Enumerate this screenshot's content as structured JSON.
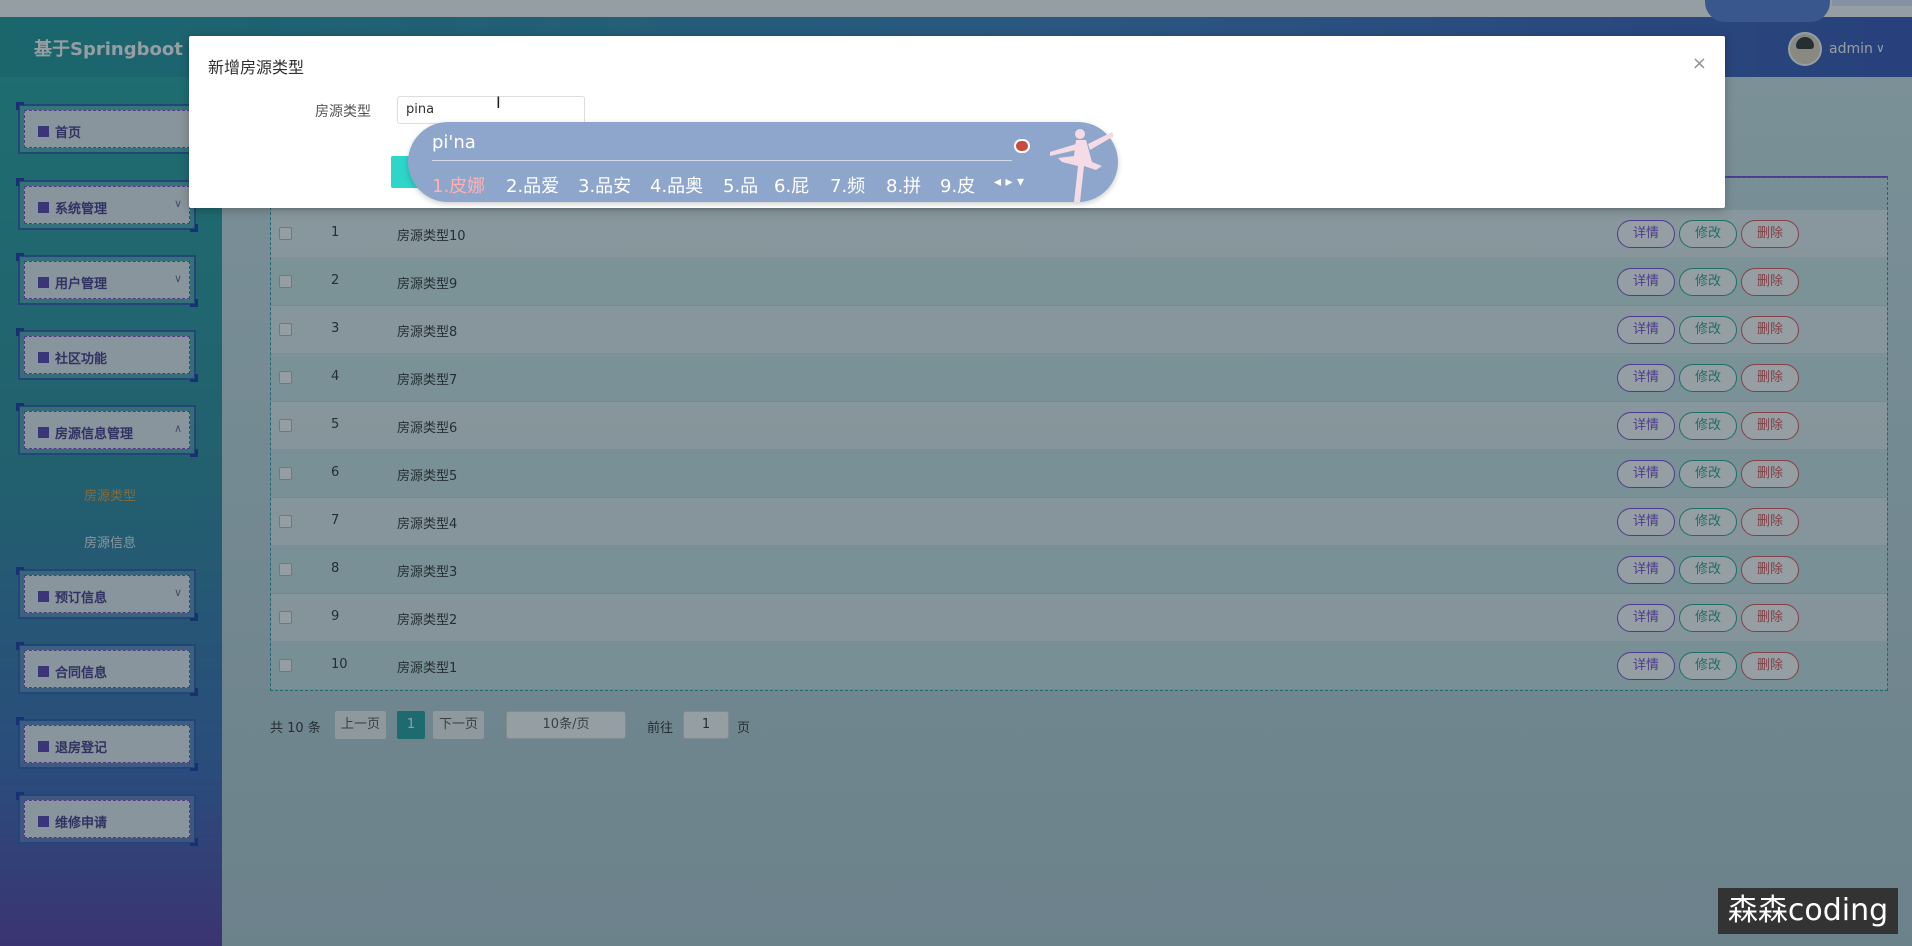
{
  "header": {
    "title": "基于Springboot",
    "username": "admin",
    "caret": "∨"
  },
  "sidebar": {
    "items": [
      {
        "label": "首页",
        "icon": "home-icon",
        "caret": ""
      },
      {
        "label": "系统管理",
        "icon": "grid-icon",
        "caret": "∨"
      },
      {
        "label": "用户管理",
        "icon": "folder-icon",
        "caret": "∨"
      },
      {
        "label": "社区功能",
        "icon": "grid-icon",
        "caret": ""
      },
      {
        "label": "房源信息管理",
        "icon": "doc-icon",
        "caret": "∧"
      },
      {
        "label": "预订信息",
        "icon": "doc-icon",
        "caret": "∨"
      },
      {
        "label": "合同信息",
        "icon": "grid-icon",
        "caret": ""
      },
      {
        "label": "退房登记",
        "icon": "grid-icon",
        "caret": ""
      },
      {
        "label": "维修申请",
        "icon": "circle-icon",
        "caret": ""
      }
    ],
    "subitems": [
      {
        "label": "房源类型",
        "active": true
      },
      {
        "label": "房源信息",
        "active": false
      }
    ]
  },
  "table": {
    "rows": [
      {
        "index": "1",
        "name": "房源类型10"
      },
      {
        "index": "2",
        "name": "房源类型9"
      },
      {
        "index": "3",
        "name": "房源类型8"
      },
      {
        "index": "4",
        "name": "房源类型7"
      },
      {
        "index": "5",
        "name": "房源类型6"
      },
      {
        "index": "6",
        "name": "房源类型5"
      },
      {
        "index": "7",
        "name": "房源类型4"
      },
      {
        "index": "8",
        "name": "房源类型3"
      },
      {
        "index": "9",
        "name": "房源类型2"
      },
      {
        "index": "10",
        "name": "房源类型1"
      }
    ],
    "actions": {
      "detail": "详情",
      "edit": "修改",
      "delete": "删除"
    }
  },
  "pagination": {
    "total": "共 10 条",
    "prev": "上一页",
    "current": "1",
    "next": "下一页",
    "page_size": "10条/页",
    "goto": "前往",
    "jump_value": "1",
    "page_suffix": "页"
  },
  "dialog": {
    "title": "新增房源类型",
    "close": "×",
    "field_label": "房源类型",
    "field_value": "pina",
    "cursor": "I"
  },
  "ime": {
    "composition": "pi'na",
    "candidates": [
      "1.皮娜",
      "2.品爱",
      "3.品安",
      "4.品奥",
      "5.品",
      "6.屁",
      "7.频",
      "8.拼",
      "9.皮"
    ],
    "arrows": "◂ ▸ ▾"
  },
  "watermark": "森森coding",
  "colors": {
    "accent": "#25a2a0",
    "detail": "#7a4ed8",
    "edit": "#28a88e",
    "delete": "#e05454",
    "active_sub": "#e8a23d"
  }
}
